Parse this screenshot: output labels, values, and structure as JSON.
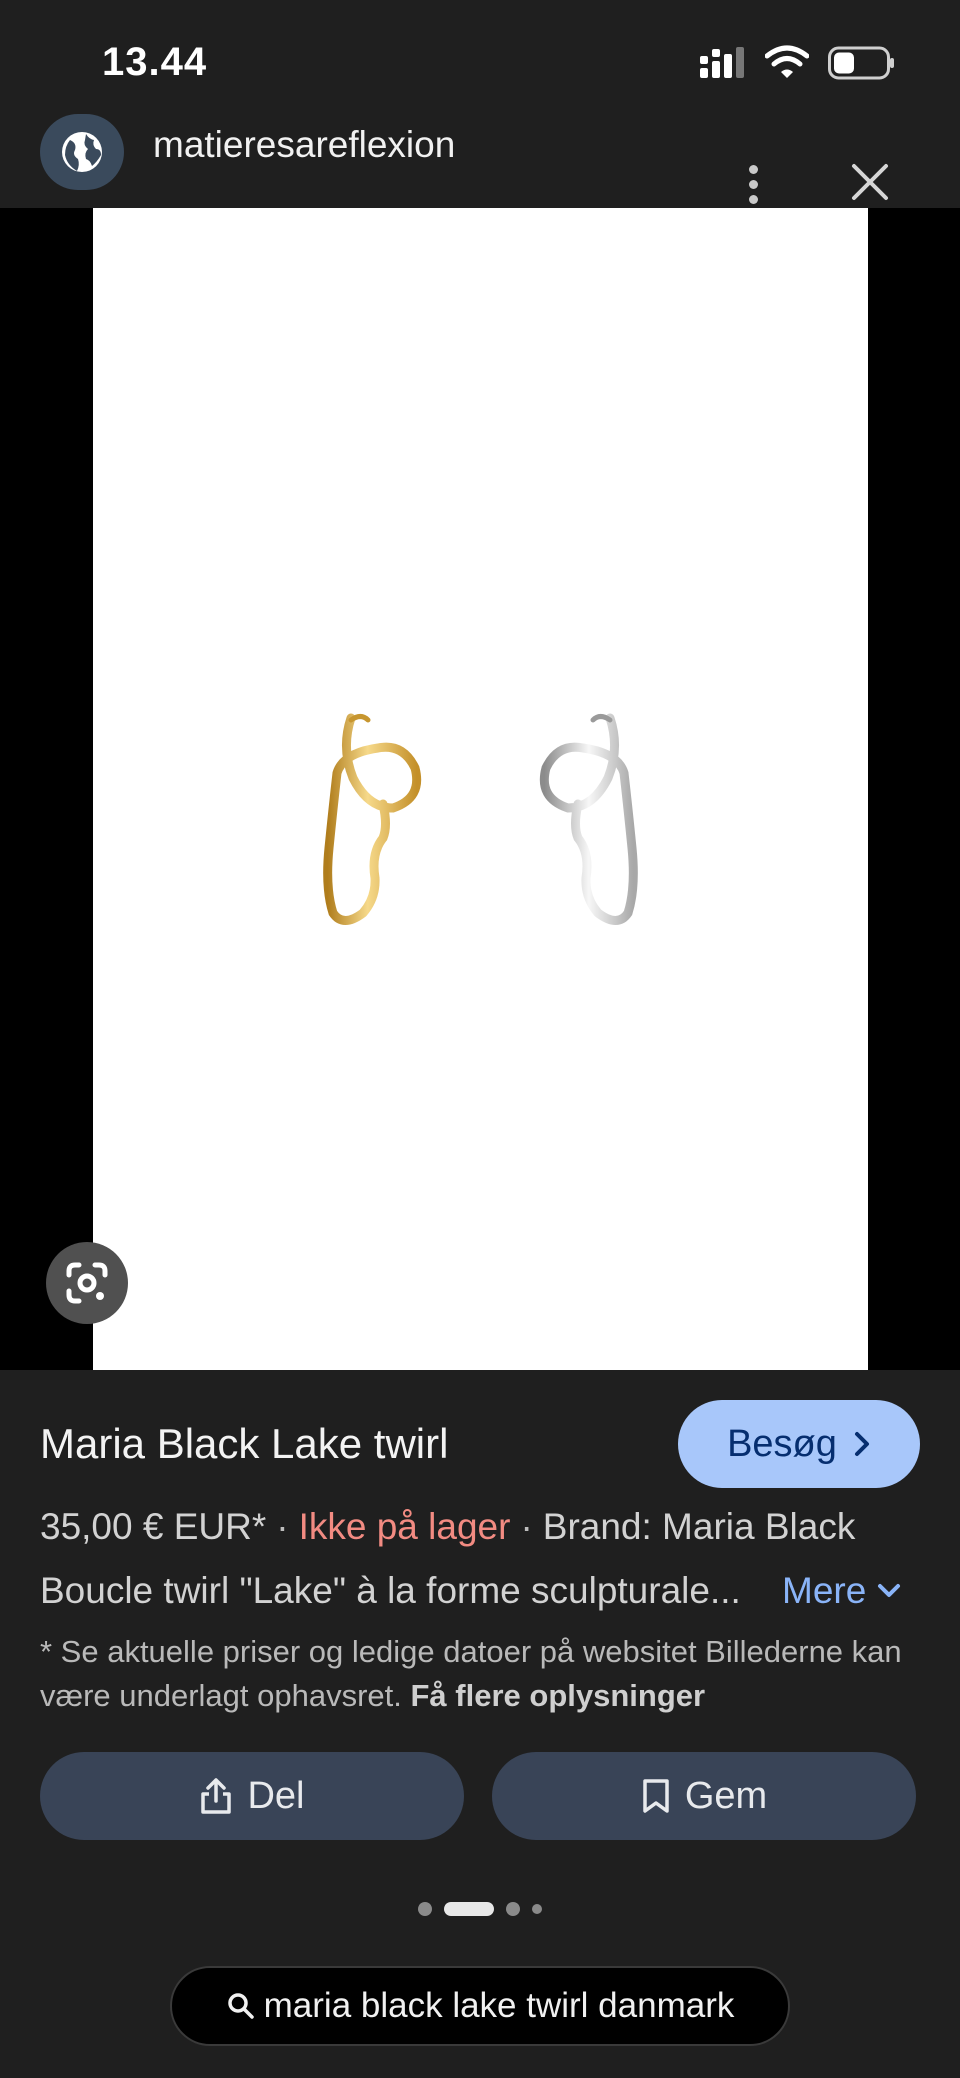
{
  "status_bar": {
    "time": "13.44"
  },
  "header": {
    "site_name": "matieresareflexion"
  },
  "product": {
    "title": "Maria Black Lake twirl",
    "visit_label": "Besøg",
    "price": "35,00 € EUR*",
    "stock": "Ikke på lager",
    "brand": "Brand: Maria Black",
    "description": "Boucle twirl \"Lake\" à la forme sculpturale...",
    "more_label": "Mere",
    "disclaimer": "* Se aktuelle priser og ledige datoer på websitet Billederne kan være underlagt ophavsret.",
    "disclaimer_link": "Få flere oplysninger"
  },
  "actions": {
    "share_label": "Del",
    "save_label": "Gem"
  },
  "search": {
    "query": "maria black lake twirl danmark"
  },
  "colors": {
    "accent": "#a8c7fa",
    "stock_red": "#f28b82",
    "link_blue": "#8ab4f8",
    "background": "#1f1f1f",
    "button_bg": "#394457"
  },
  "icons": [
    "globe-icon",
    "more-vert-icon",
    "close-icon",
    "google-lens-icon",
    "chevron-right-icon",
    "chevron-down-icon",
    "share-icon",
    "bookmark-icon",
    "search-icon",
    "signal-icon",
    "wifi-icon",
    "battery-icon"
  ]
}
